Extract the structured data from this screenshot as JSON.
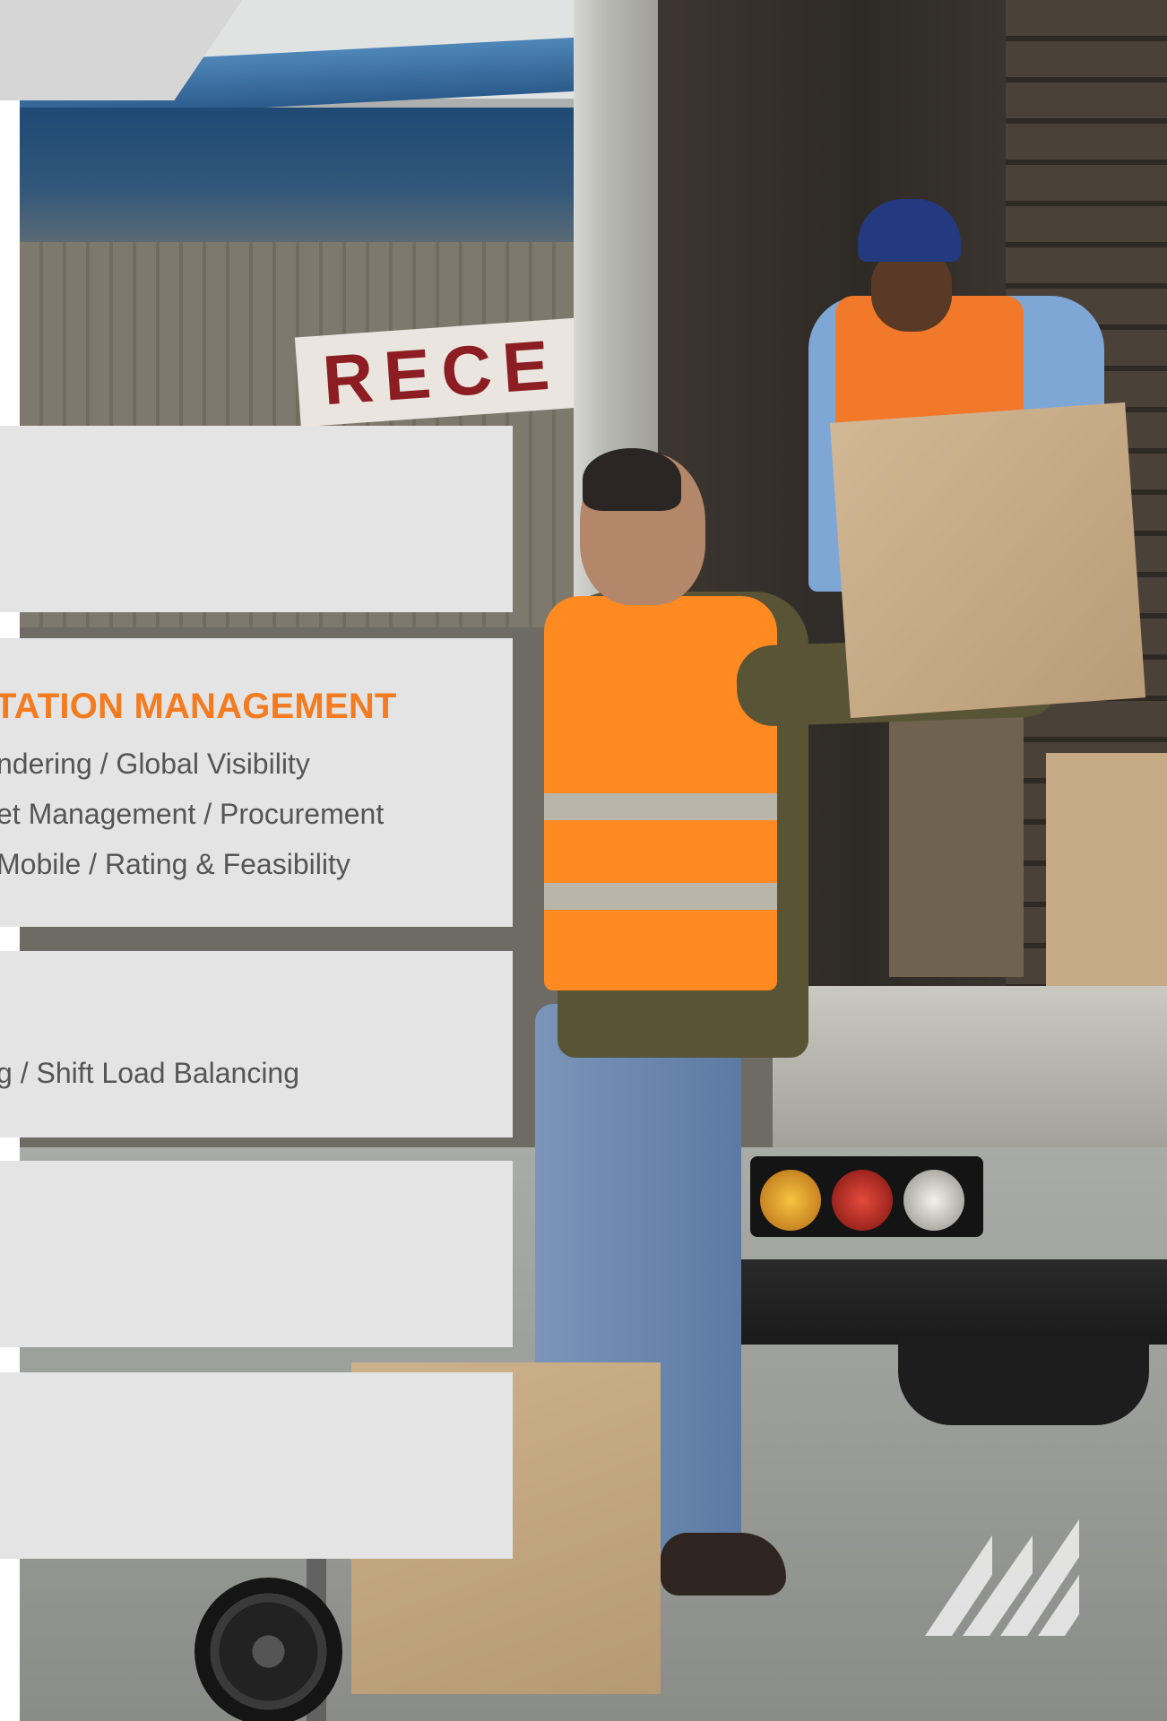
{
  "panels": [
    {
      "id": "panel-1"
    },
    {
      "id": "panel-2",
      "title": "TATION MANAGEMENT",
      "lines": [
        "ndering / Global Visibility",
        "et Management / Procurement",
        "Mobile / Rating & Feasibility"
      ]
    },
    {
      "id": "panel-3",
      "lines": [
        "g / Shift Load Balancing"
      ]
    },
    {
      "id": "panel-4"
    },
    {
      "id": "panel-5"
    }
  ],
  "photo": {
    "sign_text": "RECE"
  },
  "colors": {
    "accent": "#f47b20",
    "panel": "#e4e4e4",
    "text": "#555555",
    "tab": "#d6d6d6"
  },
  "logo": {
    "icon": "striped-logo-icon"
  }
}
